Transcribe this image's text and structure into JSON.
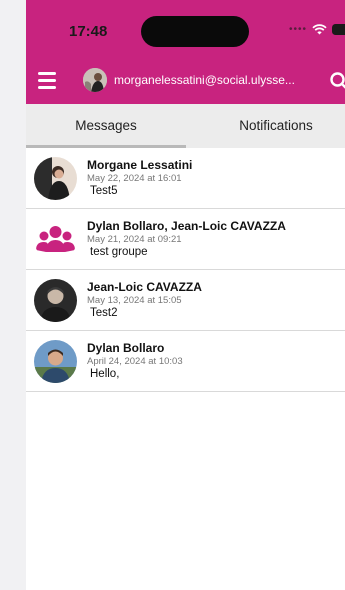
{
  "status_bar": {
    "time": "17:48"
  },
  "header": {
    "account_email": "morganelessatini@social.ulysse...",
    "menu_icon": "hamburger-menu-icon",
    "search_icon": "search-icon"
  },
  "tabs": [
    {
      "label": "Messages",
      "active": true
    },
    {
      "label": "Notifications",
      "active": false
    }
  ],
  "conversations": [
    {
      "name": "Morgane Lessatini",
      "date": "May 22, 2024 at 16:01",
      "preview": "Test5",
      "avatar": "photo"
    },
    {
      "name": "Dylan Bollaro, Jean-Loic CAVAZZA",
      "date": "May 21, 2024 at 09:21",
      "preview": "test groupe",
      "avatar": "group-icon"
    },
    {
      "name": "Jean-Loic CAVAZZA",
      "date": "May 13, 2024 at 15:05",
      "preview": "Test2",
      "avatar": "photo"
    },
    {
      "name": "Dylan Bollaro",
      "date": "April 24, 2024 at 10:03",
      "preview": "Hello,",
      "avatar": "photo"
    }
  ],
  "colors": {
    "brand": "#c8237f",
    "tab_bar": "#ececec",
    "group_icon": "#c8237f"
  }
}
